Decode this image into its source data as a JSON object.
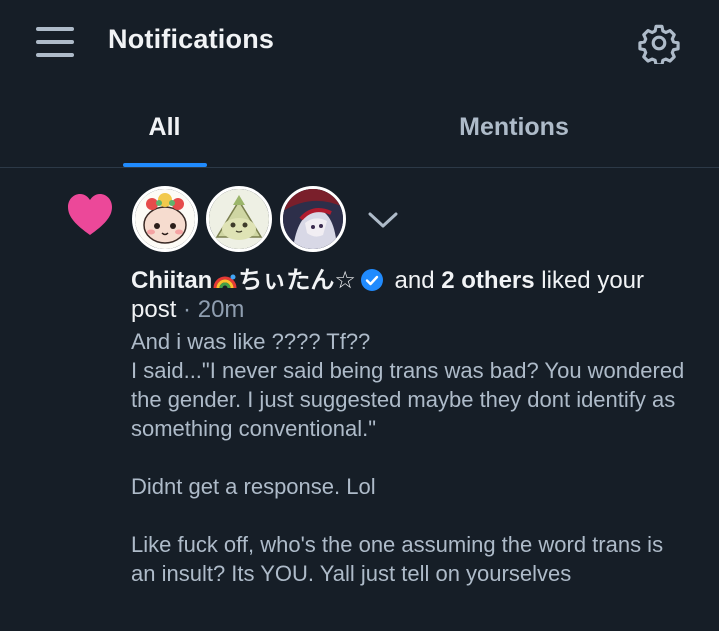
{
  "header": {
    "title": "Notifications",
    "menu_icon": "hamburger-menu-icon",
    "settings_icon": "gear-icon"
  },
  "tabs": [
    {
      "label": "All",
      "active": true
    },
    {
      "label": "Mentions",
      "active": false
    }
  ],
  "colors": {
    "background": "#161e27",
    "accent": "#208bfe",
    "heart": "#ec4899",
    "text_primary": "#f1f3f5",
    "text_secondary": "#aebbc9"
  },
  "notification": {
    "type_icon": "heart-icon",
    "avatars": [
      "avatar-1",
      "avatar-2",
      "avatar-3"
    ],
    "author": "Chiitan",
    "author_suffix": "ちぃたん☆",
    "verified_icon": "verified-check-icon",
    "and_text": "and",
    "others": "2 others",
    "action": "liked",
    "object": "your post",
    "separator": "·",
    "time": "20m",
    "post_lines": [
      "And i was like ???? Tf??",
      "I said...\"I never said being trans was bad? You wondered the gender. I just suggested maybe they dont identify as something conventional.\"",
      "",
      "Didnt get a response. Lol",
      "",
      "Like fuck off, who's the one assuming the word trans is an insult? Its YOU. Yall just tell on yourselves"
    ]
  }
}
